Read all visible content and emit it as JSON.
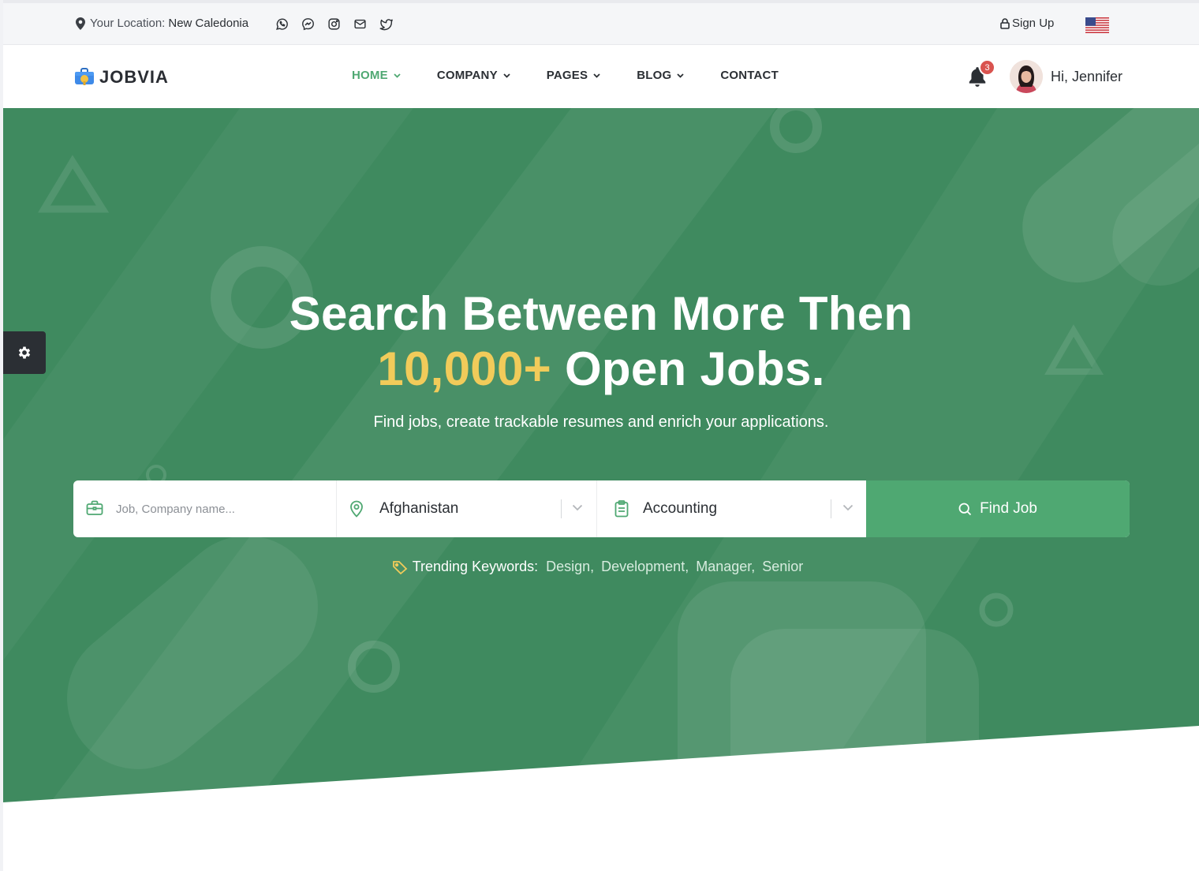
{
  "topbar": {
    "location_prefix": "Your Location:",
    "location_value": "New Caledonia",
    "social_icons": [
      "whatsapp-icon",
      "messenger-icon",
      "instagram-icon",
      "mail-icon",
      "twitter-icon"
    ],
    "signup_label": "Sign Up",
    "language_flag": "us-flag-icon"
  },
  "navbar": {
    "logo_text": "JOBVIA",
    "items": [
      {
        "label": "HOME",
        "active": true,
        "has_dropdown": true
      },
      {
        "label": "COMPANY",
        "active": false,
        "has_dropdown": true
      },
      {
        "label": "PAGES",
        "active": false,
        "has_dropdown": true
      },
      {
        "label": "BLOG",
        "active": false,
        "has_dropdown": true
      },
      {
        "label": "CONTACT",
        "active": false,
        "has_dropdown": false
      }
    ],
    "notification_count": "3",
    "greeting": "Hi, Jennifer"
  },
  "hero": {
    "title_line1": "Search Between More Then",
    "title_highlight": "10,000+",
    "title_line2_rest": "Open Jobs.",
    "subtitle": "Find jobs, create trackable resumes and enrich your applications."
  },
  "search": {
    "job_placeholder": "Job, Company name...",
    "location_value": "Afghanistan",
    "category_value": "Accounting",
    "button_label": "Find Job"
  },
  "trending": {
    "label": "Trending Keywords:",
    "keywords": [
      "Design,",
      "Development,",
      "Manager,",
      "Senior"
    ]
  },
  "colors": {
    "primary_green": "#4fa872",
    "hero_green": "#3f8a5f",
    "highlight_yellow": "#f1cb5a",
    "badge_red": "#d9534f"
  }
}
